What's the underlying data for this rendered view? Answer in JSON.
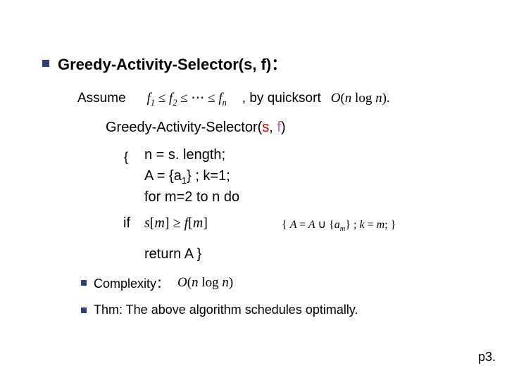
{
  "title": "Greedy-Activity-Selector(s, f)：",
  "assume": {
    "label": "Assume",
    "cond_html": "f<sub>1</sub> ≤ f<sub>2</sub> ≤ ⋯ ≤ f<sub>n</sub>",
    "by": ", by quicksort",
    "complexity": "O(n log n)."
  },
  "algo_title": {
    "name": "Greedy-Activity-Selector(",
    "arg_s": "s",
    "comma": ", ",
    "arg_f": "f",
    "close": ")"
  },
  "body": {
    "open_brace": "{",
    "n_line": "n = s. length;",
    "A_prefix": "A = {a",
    "A_sub": "1",
    "A_suffix": "} ;  k=1;",
    "for_line": "for  m=2  to  n  do",
    "if_kw": "if",
    "cond_sm": "s[m]",
    "cond_op": " ≥ ",
    "cond_fm": "f[m]",
    "if_body_open": "{ ",
    "if_A": "A = A ∪ {a",
    "if_sub": "m",
    "if_A_close": "}",
    "semi1": "  ;   ",
    "if_k": "k = m;",
    "if_body_close": "  }",
    "return": "return A  }"
  },
  "complexity": {
    "label": "Complexity：",
    "value": "O(n log n)"
  },
  "thm": "Thm: The above algorithm schedules optimally.",
  "page": "p3."
}
